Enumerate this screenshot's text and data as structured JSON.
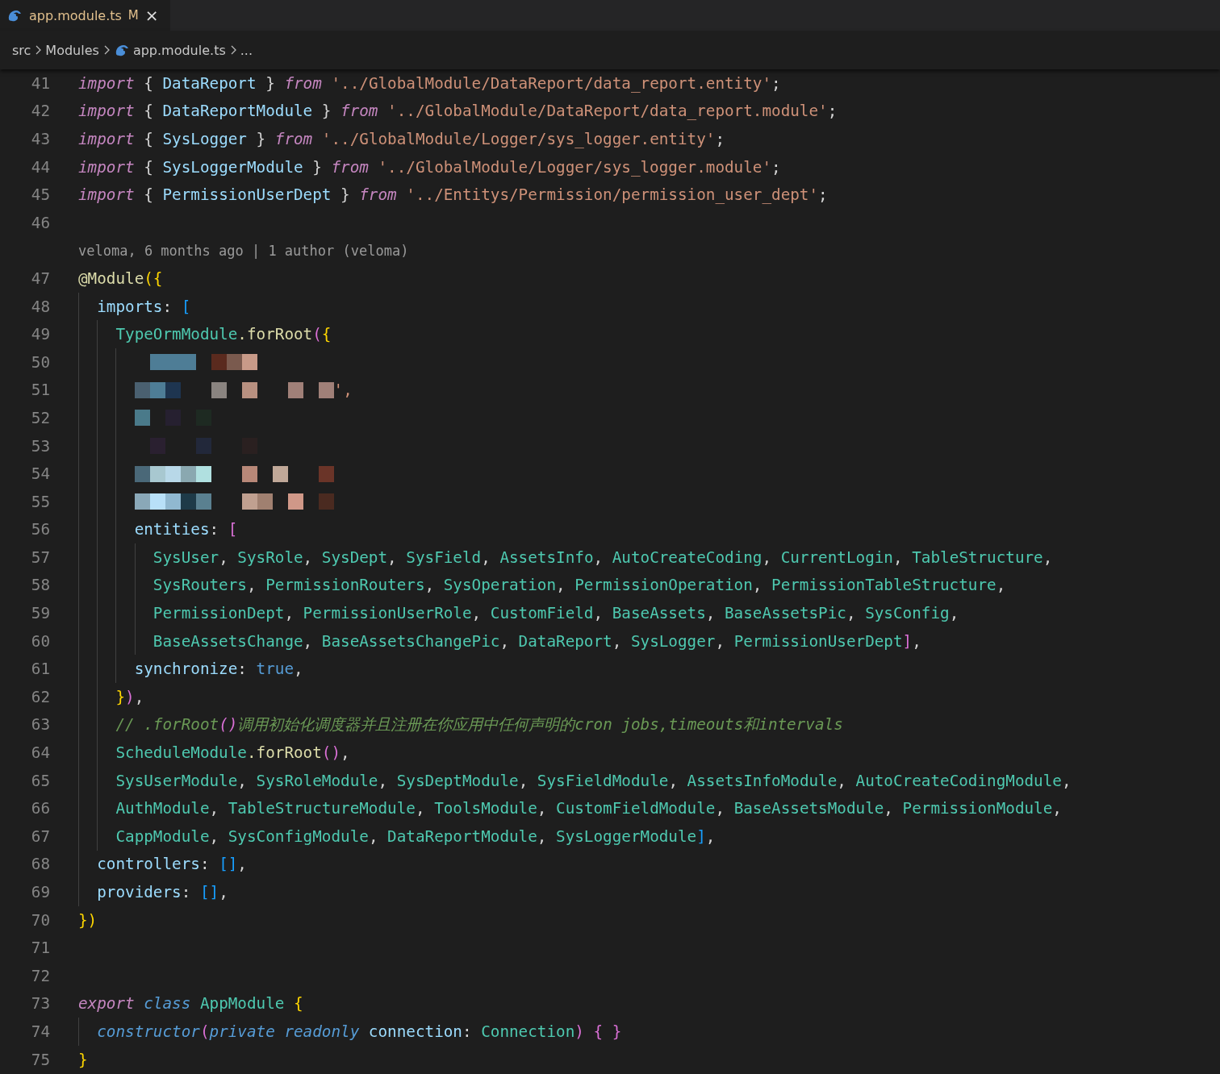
{
  "tab": {
    "title": "app.module.ts",
    "badge": "M",
    "close": "×"
  },
  "breadcrumbs": [
    {
      "kind": "folder",
      "label": "src"
    },
    {
      "kind": "folder",
      "label": "Modules"
    },
    {
      "kind": "file",
      "label": "app.module.ts"
    },
    {
      "kind": "more",
      "label": "..."
    }
  ],
  "lines": [
    {
      "kind": "code",
      "number": "41",
      "tokens": [
        {
          "kind": "k",
          "text": "import"
        },
        {
          "kind": "p",
          "text": " { "
        },
        {
          "kind": "v",
          "text": "DataReport"
        },
        {
          "kind": "p",
          "text": " } "
        },
        {
          "kind": "k",
          "text": "from"
        },
        {
          "kind": "s",
          "text": " '../GlobalModule/DataReport/data_report.entity'"
        },
        {
          "kind": "p",
          "text": ";"
        }
      ]
    },
    {
      "kind": "code",
      "number": "42",
      "tokens": [
        {
          "kind": "k",
          "text": "import"
        },
        {
          "kind": "p",
          "text": " { "
        },
        {
          "kind": "v",
          "text": "DataReportModule"
        },
        {
          "kind": "p",
          "text": " } "
        },
        {
          "kind": "k",
          "text": "from"
        },
        {
          "kind": "s",
          "text": " '../GlobalModule/DataReport/data_report.module'"
        },
        {
          "kind": "p",
          "text": ";"
        }
      ]
    },
    {
      "kind": "code",
      "number": "43",
      "tokens": [
        {
          "kind": "k",
          "text": "import"
        },
        {
          "kind": "p",
          "text": " { "
        },
        {
          "kind": "v",
          "text": "SysLogger"
        },
        {
          "kind": "p",
          "text": " } "
        },
        {
          "kind": "k",
          "text": "from"
        },
        {
          "kind": "s",
          "text": " '../GlobalModule/Logger/sys_logger.entity'"
        },
        {
          "kind": "p",
          "text": ";"
        }
      ]
    },
    {
      "kind": "code",
      "number": "44",
      "tokens": [
        {
          "kind": "k",
          "text": "import"
        },
        {
          "kind": "p",
          "text": " { "
        },
        {
          "kind": "v",
          "text": "SysLoggerModule"
        },
        {
          "kind": "p",
          "text": " } "
        },
        {
          "kind": "k",
          "text": "from"
        },
        {
          "kind": "s",
          "text": " '../GlobalModule/Logger/sys_logger.module'"
        },
        {
          "kind": "p",
          "text": ";"
        }
      ]
    },
    {
      "kind": "code",
      "number": "45",
      "tokens": [
        {
          "kind": "k",
          "text": "import"
        },
        {
          "kind": "p",
          "text": " { "
        },
        {
          "kind": "v",
          "text": "PermissionUserDept"
        },
        {
          "kind": "p",
          "text": " } "
        },
        {
          "kind": "k",
          "text": "from"
        },
        {
          "kind": "s",
          "text": " '../Entitys/Permission/permission_user_dept'"
        },
        {
          "kind": "p",
          "text": ";"
        }
      ]
    },
    {
      "kind": "code",
      "number": "46"
    },
    {
      "kind": "codelens",
      "text": "veloma, 6 months ago | 1 author (veloma)"
    },
    {
      "kind": "code",
      "number": "47",
      "tokens": [
        {
          "kind": "f",
          "text": "@Module"
        },
        {
          "kind": "b1",
          "text": "({"
        }
      ]
    },
    {
      "kind": "code",
      "number": "48",
      "tokens": [
        {
          "kind": "v",
          "text": "  imports"
        },
        {
          "kind": "p",
          "text": ": "
        },
        {
          "kind": "b3",
          "text": "["
        }
      ]
    },
    {
      "kind": "code",
      "number": "49",
      "tokens": [
        {
          "kind": "t",
          "text": "    TypeOrmModule"
        },
        {
          "kind": "f",
          "text": ".forRoot"
        },
        {
          "kind": "b2",
          "text": "("
        },
        {
          "kind": "b1",
          "text": "{"
        }
      ]
    },
    {
      "kind": "redacted",
      "number": "50"
    },
    {
      "kind": "redacted",
      "number": "51",
      "tail": "',"
    },
    {
      "kind": "redacted",
      "number": "52"
    },
    {
      "kind": "redacted",
      "number": "53"
    },
    {
      "kind": "redacted",
      "number": "54"
    },
    {
      "kind": "redacted",
      "number": "55"
    },
    {
      "kind": "code",
      "number": "56",
      "tokens": [
        {
          "kind": "v",
          "text": "      entities"
        },
        {
          "kind": "p",
          "text": ": "
        },
        {
          "kind": "b2",
          "text": "["
        }
      ]
    },
    {
      "kind": "code",
      "number": "57",
      "tokens": [
        {
          "kind": "t",
          "text": "        SysUser"
        },
        {
          "kind": "p",
          "text": ", "
        },
        {
          "kind": "t",
          "text": "SysRole"
        },
        {
          "kind": "p",
          "text": ", "
        },
        {
          "kind": "t",
          "text": "SysDept"
        },
        {
          "kind": "p",
          "text": ", "
        },
        {
          "kind": "t",
          "text": "SysField"
        },
        {
          "kind": "p",
          "text": ", "
        },
        {
          "kind": "t",
          "text": "AssetsInfo"
        },
        {
          "kind": "p",
          "text": ", "
        },
        {
          "kind": "t",
          "text": "AutoCreateCoding"
        },
        {
          "kind": "p",
          "text": ", "
        },
        {
          "kind": "t",
          "text": "CurrentLogin"
        },
        {
          "kind": "p",
          "text": ", "
        },
        {
          "kind": "t",
          "text": "TableStructure"
        },
        {
          "kind": "p",
          "text": ","
        }
      ]
    },
    {
      "kind": "code",
      "number": "58",
      "tokens": [
        {
          "kind": "t",
          "text": "        SysRouters"
        },
        {
          "kind": "p",
          "text": ", "
        },
        {
          "kind": "t",
          "text": "PermissionRouters"
        },
        {
          "kind": "p",
          "text": ", "
        },
        {
          "kind": "t",
          "text": "SysOperation"
        },
        {
          "kind": "p",
          "text": ", "
        },
        {
          "kind": "t",
          "text": "PermissionOperation"
        },
        {
          "kind": "p",
          "text": ", "
        },
        {
          "kind": "t",
          "text": "PermissionTableStructure"
        },
        {
          "kind": "p",
          "text": ","
        }
      ]
    },
    {
      "kind": "code",
      "number": "59",
      "tokens": [
        {
          "kind": "t",
          "text": "        PermissionDept"
        },
        {
          "kind": "p",
          "text": ", "
        },
        {
          "kind": "t",
          "text": "PermissionUserRole"
        },
        {
          "kind": "p",
          "text": ", "
        },
        {
          "kind": "t",
          "text": "CustomField"
        },
        {
          "kind": "p",
          "text": ", "
        },
        {
          "kind": "t",
          "text": "BaseAssets"
        },
        {
          "kind": "p",
          "text": ", "
        },
        {
          "kind": "t",
          "text": "BaseAssetsPic"
        },
        {
          "kind": "p",
          "text": ", "
        },
        {
          "kind": "t",
          "text": "SysConfig"
        },
        {
          "kind": "p",
          "text": ","
        }
      ]
    },
    {
      "kind": "code",
      "number": "60",
      "tokens": [
        {
          "kind": "t",
          "text": "        BaseAssetsChange"
        },
        {
          "kind": "p",
          "text": ", "
        },
        {
          "kind": "t",
          "text": "BaseAssetsChangePic"
        },
        {
          "kind": "p",
          "text": ", "
        },
        {
          "kind": "t",
          "text": "DataReport"
        },
        {
          "kind": "p",
          "text": ", "
        },
        {
          "kind": "t",
          "text": "SysLogger"
        },
        {
          "kind": "p",
          "text": ", "
        },
        {
          "kind": "t",
          "text": "PermissionUserDept"
        },
        {
          "kind": "b2",
          "text": "]"
        },
        {
          "kind": "p",
          "text": ","
        }
      ]
    },
    {
      "kind": "code",
      "number": "61",
      "tokens": [
        {
          "kind": "v",
          "text": "      synchronize"
        },
        {
          "kind": "p",
          "text": ": "
        },
        {
          "kind": "n",
          "text": "true"
        },
        {
          "kind": "p",
          "text": ","
        }
      ]
    },
    {
      "kind": "code",
      "number": "62",
      "tokens": [
        {
          "kind": "b1",
          "text": "    }"
        },
        {
          "kind": "b2",
          "text": ")"
        },
        {
          "kind": "p",
          "text": ","
        }
      ]
    },
    {
      "kind": "code",
      "number": "63",
      "tokens": [
        {
          "kind": "c",
          "text": "    // .forRoot"
        },
        {
          "kind": "cb",
          "text": "()"
        },
        {
          "kind": "c",
          "text": "调用初始化调度器并且注册在你应用中任何声明的cron jobs,timeouts和intervals"
        }
      ]
    },
    {
      "kind": "code",
      "number": "64",
      "tokens": [
        {
          "kind": "t",
          "text": "    ScheduleModule"
        },
        {
          "kind": "f",
          "text": ".forRoot"
        },
        {
          "kind": "b2",
          "text": "()"
        },
        {
          "kind": "p",
          "text": ","
        }
      ]
    },
    {
      "kind": "code",
      "number": "65",
      "tokens": [
        {
          "kind": "t",
          "text": "    SysUserModule"
        },
        {
          "kind": "p",
          "text": ", "
        },
        {
          "kind": "t",
          "text": "SysRoleModule"
        },
        {
          "kind": "p",
          "text": ", "
        },
        {
          "kind": "t",
          "text": "SysDeptModule"
        },
        {
          "kind": "p",
          "text": ", "
        },
        {
          "kind": "t",
          "text": "SysFieldModule"
        },
        {
          "kind": "p",
          "text": ", "
        },
        {
          "kind": "t",
          "text": "AssetsInfoModule"
        },
        {
          "kind": "p",
          "text": ", "
        },
        {
          "kind": "t",
          "text": "AutoCreateCodingModule"
        },
        {
          "kind": "p",
          "text": ","
        }
      ]
    },
    {
      "kind": "code",
      "number": "66",
      "tokens": [
        {
          "kind": "t",
          "text": "    AuthModule"
        },
        {
          "kind": "p",
          "text": ", "
        },
        {
          "kind": "t",
          "text": "TableStructureModule"
        },
        {
          "kind": "p",
          "text": ", "
        },
        {
          "kind": "t",
          "text": "ToolsModule"
        },
        {
          "kind": "p",
          "text": ", "
        },
        {
          "kind": "t",
          "text": "CustomFieldModule"
        },
        {
          "kind": "p",
          "text": ", "
        },
        {
          "kind": "t",
          "text": "BaseAssetsModule"
        },
        {
          "kind": "p",
          "text": ", "
        },
        {
          "kind": "t",
          "text": "PermissionModule"
        },
        {
          "kind": "p",
          "text": ","
        }
      ]
    },
    {
      "kind": "code",
      "number": "67",
      "tokens": [
        {
          "kind": "t",
          "text": "    CappModule"
        },
        {
          "kind": "p",
          "text": ", "
        },
        {
          "kind": "t",
          "text": "SysConfigModule"
        },
        {
          "kind": "p",
          "text": ", "
        },
        {
          "kind": "t",
          "text": "DataReportModule"
        },
        {
          "kind": "p",
          "text": ", "
        },
        {
          "kind": "t",
          "text": "SysLoggerModule"
        },
        {
          "kind": "b3",
          "text": "]"
        },
        {
          "kind": "p",
          "text": ","
        }
      ]
    },
    {
      "kind": "code",
      "number": "68",
      "tokens": [
        {
          "kind": "v",
          "text": "  controllers"
        },
        {
          "kind": "p",
          "text": ": "
        },
        {
          "kind": "b3",
          "text": "[]"
        },
        {
          "kind": "p",
          "text": ","
        }
      ]
    },
    {
      "kind": "code",
      "number": "69",
      "tokens": [
        {
          "kind": "v",
          "text": "  providers"
        },
        {
          "kind": "p",
          "text": ": "
        },
        {
          "kind": "b3",
          "text": "[]"
        },
        {
          "kind": "p",
          "text": ","
        }
      ]
    },
    {
      "kind": "code",
      "number": "70",
      "tokens": [
        {
          "kind": "b1",
          "text": "})"
        }
      ]
    },
    {
      "kind": "code",
      "number": "71"
    },
    {
      "kind": "code",
      "number": "72"
    },
    {
      "kind": "code",
      "number": "73",
      "tokens": [
        {
          "kind": "k",
          "text": "export"
        },
        {
          "kind": "kb",
          "text": " class"
        },
        {
          "kind": "t",
          "text": " AppModule"
        },
        {
          "kind": "b1",
          "text": " {"
        }
      ]
    },
    {
      "kind": "code",
      "number": "74",
      "tokens": [
        {
          "kind": "kb",
          "text": "  constructor"
        },
        {
          "kind": "b2",
          "text": "("
        },
        {
          "kind": "kb",
          "text": "private readonly"
        },
        {
          "kind": "v",
          "text": " connection"
        },
        {
          "kind": "p",
          "text": ": "
        },
        {
          "kind": "t",
          "text": "Connection"
        },
        {
          "kind": "b2",
          "text": ")"
        },
        {
          "kind": "b2",
          "text": " { }"
        }
      ]
    },
    {
      "kind": "code",
      "number": "75",
      "tokens": [
        {
          "kind": "b1",
          "text": "}"
        }
      ]
    }
  ]
}
